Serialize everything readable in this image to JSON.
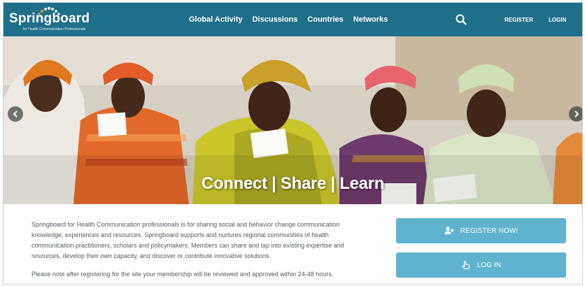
{
  "header": {
    "logo_text": "Springboard",
    "logo_tagline": "for Health Communication Professionals",
    "nav": [
      "Global Activity",
      "Discussions",
      "Countries",
      "Networks"
    ],
    "search_icon": "search-icon",
    "register_label": "REGISTER",
    "login_label": "LOGIN"
  },
  "hero": {
    "caption": "Connect | Share | Learn",
    "prev_icon": "chevron-left-icon",
    "next_icon": "chevron-right-icon"
  },
  "content": {
    "intro": "Springboard for Health Communication professionals is for sharing social and behavior change communication knowledge, experiences and resources. Springboard supports and nurtures regional communities of health communication practitioners, scholars and policymakers. Members can share and tap into existing expertise and resources, develop their own capacity, and discover or contribute innovative solutions.",
    "note": "Please note after registering for the site your membership will be reviewed and approved within 24-48 hours.",
    "register_button": "REGISTER NOW!",
    "login_button": "LOG IN"
  },
  "colors": {
    "header_bg": "#1f6f8b",
    "button_bg": "#5fb3cf",
    "body_text": "#555b60"
  }
}
